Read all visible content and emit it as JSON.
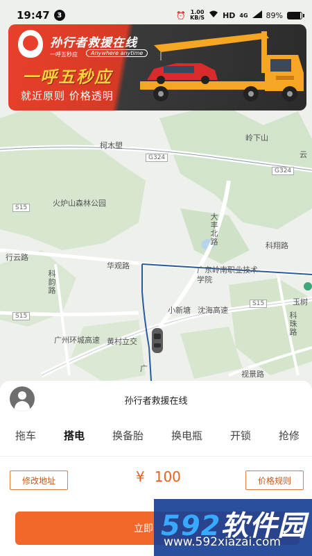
{
  "status_bar": {
    "time": "19:47",
    "notification_count": "3",
    "net_speed_value": "1.00",
    "net_speed_unit": "KB/S",
    "hd": "HD",
    "signal": "4G",
    "battery": "89%",
    "battery_level": 0.89
  },
  "banner": {
    "brand_name": "孙行者救援在线",
    "tag_a": "一呼五秒应",
    "tag_b": "Anywhere anytime",
    "slogan": "一呼五秒应",
    "sub_slogan": "就近原则  价格透明"
  },
  "map": {
    "labels": {
      "kemumeng": "柯木塱",
      "liaoxiashan": "岭下山",
      "yun": "云",
      "huolushan": "火炉山森林公园",
      "dafeng_road": "大丰北路",
      "kexiang_road": "科翔路",
      "xingyun_road": "行云路",
      "keyun_road": "科韵路",
      "huaguan_road": "华观路",
      "college": "广东岭南职业技术学院",
      "yushu": "玉树",
      "xiaoxintang": "小新塘",
      "guanghai": "沈海高速",
      "kezhu_road": "科珠路",
      "huancheng": "广州环城高速",
      "huangcun": "黄村立交",
      "guangyuan": "广",
      "shijingtang": "视景路"
    },
    "road_tags": {
      "g324_a": "G324",
      "g324_b": "G324",
      "s15_a": "S15",
      "s15_b": "S15",
      "s15_side": "S15"
    }
  },
  "sheet": {
    "title": "孙行者救援在线",
    "tabs": [
      "拖车",
      "搭电",
      "换备胎",
      "换电瓶",
      "开锁",
      "抢修"
    ],
    "active_tab": "搭电",
    "modify_address": "修改地址",
    "price_symbol": "¥",
    "price_value": "100",
    "price_rules": "价格规则",
    "primary_button": "立即"
  },
  "watermark": {
    "brand_num": "592",
    "brand_text": "软件园",
    "url": "www.592xiazai.com"
  },
  "colors": {
    "accent": "#f1682a",
    "banner_red": "#e8402a",
    "slogan_yellow": "#ffd23a",
    "route_blue": "#2a5a9c"
  }
}
